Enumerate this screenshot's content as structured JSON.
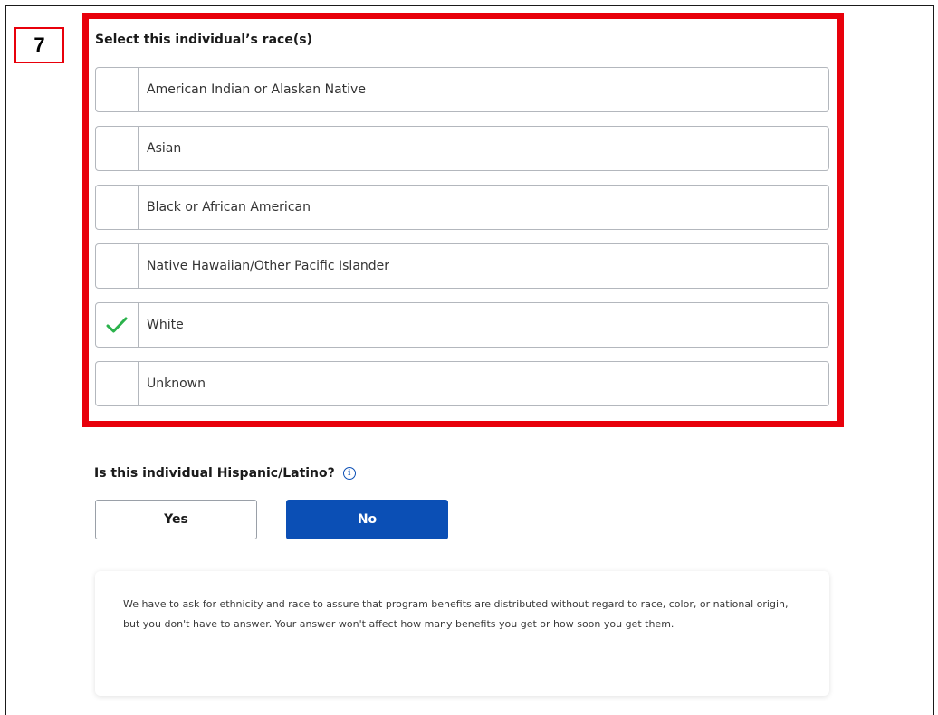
{
  "step_badge": "7",
  "race": {
    "title": "Select this individual’s race(s)",
    "options": [
      {
        "label": "American Indian or Alaskan Native",
        "checked": false
      },
      {
        "label": "Asian",
        "checked": false
      },
      {
        "label": "Black or African American",
        "checked": false
      },
      {
        "label": "Native Hawaiian/Other Pacific Islander",
        "checked": false
      },
      {
        "label": "White",
        "checked": true
      },
      {
        "label": "Unknown",
        "checked": false
      }
    ]
  },
  "hispanic": {
    "question": "Is this individual Hispanic/Latino?",
    "info_icon": "info-icon",
    "yes_label": "Yes",
    "no_label": "No",
    "selected": "No"
  },
  "note": {
    "text": "We have to ask for ethnicity and race to assure that program benefits are distributed without regard to race, color, or national origin, but you don't have to answer. Your answer won't affect how many benefits you get or how soon you get them."
  },
  "colors": {
    "highlight": "#e8000b",
    "primary": "#0b4fb5",
    "check": "#2bb24c"
  }
}
